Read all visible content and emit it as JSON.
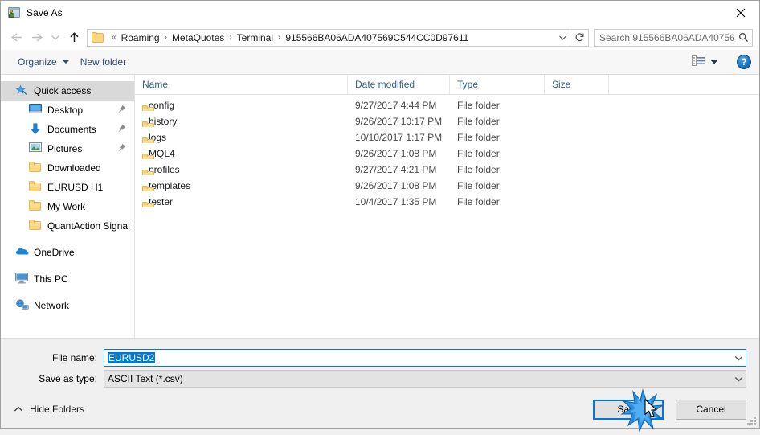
{
  "window": {
    "title": "Save As",
    "title_icon": "save-as-icon",
    "close_icon": "close-icon"
  },
  "navigation": {
    "back_icon": "back-arrow-icon",
    "forward_icon": "forward-arrow-icon",
    "recent_icon": "chevron-down-icon",
    "up_icon": "up-arrow-icon",
    "folder_icon": "folder-icon",
    "breadcrumb_prefix": "«",
    "breadcrumbs": [
      "Roaming",
      "MetaQuotes",
      "Terminal",
      "915566BA06ADA407569C544CC0D97611"
    ],
    "breadcrumb_separator": "›",
    "dropdown_icon": "chevron-down-icon",
    "refresh_icon": "refresh-icon"
  },
  "search": {
    "placeholder": "Search 915566BA06ADA40756...",
    "icon": "search-icon"
  },
  "toolbar": {
    "organize_label": "Organize",
    "new_folder_label": "New folder",
    "view_icon": "view-layout-icon",
    "view_caret_icon": "chevron-down-icon",
    "help_label": "?",
    "help_icon": "help-icon"
  },
  "sidebar": {
    "items": [
      {
        "label": "Quick access",
        "icon": "star-pin-icon",
        "level": "root",
        "selected": true,
        "pinned": false
      },
      {
        "label": "Desktop",
        "icon": "desktop-icon",
        "level": "child",
        "selected": false,
        "pinned": true
      },
      {
        "label": "Documents",
        "icon": "documents-icon",
        "level": "child",
        "selected": false,
        "pinned": true
      },
      {
        "label": "Pictures",
        "icon": "pictures-icon",
        "level": "child",
        "selected": false,
        "pinned": true
      },
      {
        "label": "Downloaded",
        "icon": "folder-icon",
        "level": "child",
        "selected": false,
        "pinned": false
      },
      {
        "label": "EURUSD H1",
        "icon": "folder-icon",
        "level": "child",
        "selected": false,
        "pinned": false
      },
      {
        "label": "My Work",
        "icon": "folder-icon",
        "level": "child",
        "selected": false,
        "pinned": false
      },
      {
        "label": "QuantAction Signal",
        "icon": "folder-icon",
        "level": "child",
        "selected": false,
        "pinned": false
      },
      {
        "label": "",
        "icon": "gap",
        "level": "gap",
        "selected": false,
        "pinned": false
      },
      {
        "label": "OneDrive",
        "icon": "onedrive-icon",
        "level": "root",
        "selected": false,
        "pinned": false
      },
      {
        "label": "",
        "icon": "gap",
        "level": "gap",
        "selected": false,
        "pinned": false
      },
      {
        "label": "This PC",
        "icon": "this-pc-icon",
        "level": "root",
        "selected": false,
        "pinned": false
      },
      {
        "label": "",
        "icon": "gap",
        "level": "gap",
        "selected": false,
        "pinned": false
      },
      {
        "label": "Network",
        "icon": "network-icon",
        "level": "root",
        "selected": false,
        "pinned": false
      }
    ]
  },
  "filelist": {
    "columns": [
      "Name",
      "Date modified",
      "Type",
      "Size"
    ],
    "sort_column": "Name",
    "sort_direction": "ascending",
    "rows": [
      {
        "name": "config",
        "date": "9/27/2017 4:44 PM",
        "type": "File folder",
        "size": "",
        "icon": "folder-icon"
      },
      {
        "name": "history",
        "date": "9/26/2017 10:17 PM",
        "type": "File folder",
        "size": "",
        "icon": "folder-icon"
      },
      {
        "name": "logs",
        "date": "10/10/2017 1:17 PM",
        "type": "File folder",
        "size": "",
        "icon": "folder-icon"
      },
      {
        "name": "MQL4",
        "date": "9/26/2017 1:08 PM",
        "type": "File folder",
        "size": "",
        "icon": "folder-icon"
      },
      {
        "name": "profiles",
        "date": "9/27/2017 4:21 PM",
        "type": "File folder",
        "size": "",
        "icon": "folder-icon"
      },
      {
        "name": "templates",
        "date": "9/26/2017 1:08 PM",
        "type": "File folder",
        "size": "",
        "icon": "folder-icon"
      },
      {
        "name": "tester",
        "date": "10/4/2017 1:35 PM",
        "type": "File folder",
        "size": "",
        "icon": "folder-icon"
      }
    ]
  },
  "form": {
    "filename_label": "File name:",
    "filename_value": "EURUSD2",
    "filename_selected": true,
    "savetype_label": "Save as type:",
    "savetype_value": "ASCII Text (*.csv)",
    "dropdown_icon": "chevron-down-icon"
  },
  "buttons": {
    "hide_folders_label": "Hide Folders",
    "hide_folders_icon": "chevron-up-icon",
    "save_label": "Save",
    "cancel_label": "Cancel"
  },
  "colors": {
    "accent": "#0078d7",
    "selection": "#0078d7",
    "header_text": "#33628f",
    "toolbar_link": "#2b4b78",
    "folder_fill": "#f9d271",
    "sidebar_selected": "#d9d9d9"
  },
  "cursor": {
    "click_effect": "click-burst",
    "pointer_icon": "mouse-pointer-icon",
    "over_element": "Save"
  }
}
